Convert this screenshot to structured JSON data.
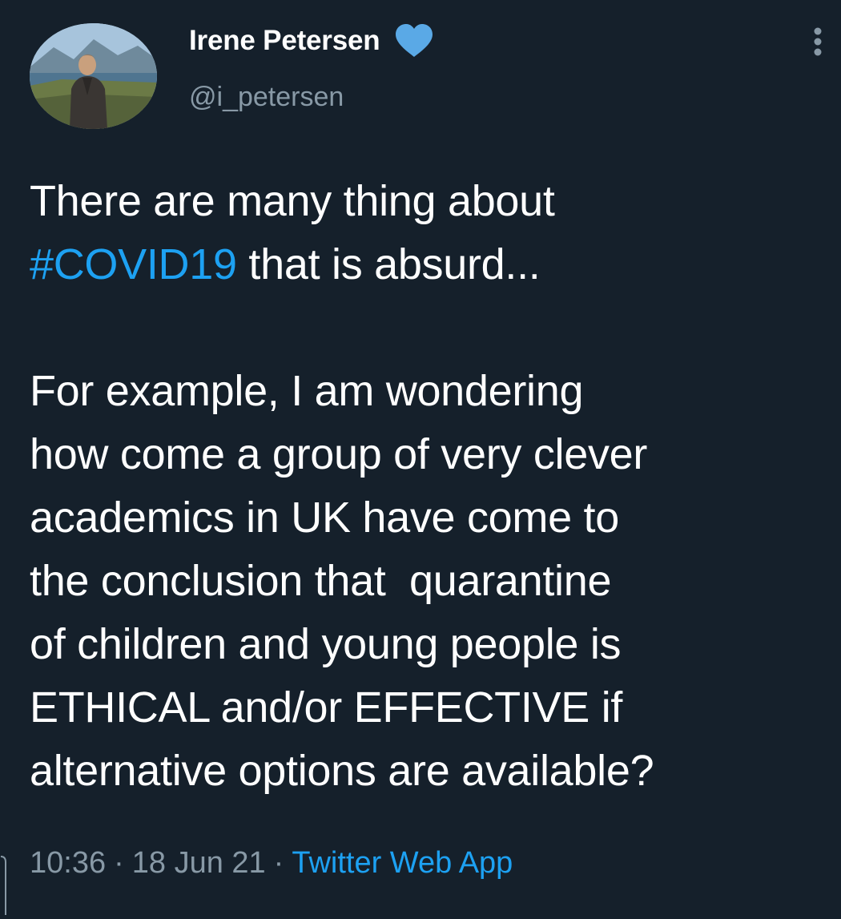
{
  "user": {
    "display_name": "Irene Petersen",
    "handle": "@i_petersen",
    "verified": true
  },
  "tweet": {
    "lines": [
      {
        "parts": [
          {
            "text": "There are many thing about",
            "type": "text"
          }
        ]
      },
      {
        "parts": [
          {
            "text": "#COVID19",
            "type": "hashtag"
          },
          {
            "text": " that is absurd...",
            "type": "text"
          }
        ]
      },
      {
        "parts": [
          {
            "text": "",
            "type": "text"
          }
        ]
      },
      {
        "parts": [
          {
            "text": "For example, I am wondering",
            "type": "text"
          }
        ]
      },
      {
        "parts": [
          {
            "text": "how come a group of very clever",
            "type": "text"
          }
        ]
      },
      {
        "parts": [
          {
            "text": "academics in UK have come to",
            "type": "text"
          }
        ]
      },
      {
        "parts": [
          {
            "text": "the conclusion that  quarantine",
            "type": "text"
          }
        ]
      },
      {
        "parts": [
          {
            "text": "of children and young people is",
            "type": "text"
          }
        ]
      },
      {
        "parts": [
          {
            "text": "ETHICAL and/or EFFECTIVE if",
            "type": "text"
          }
        ]
      },
      {
        "parts": [
          {
            "text": "alternative options are available?",
            "type": "text"
          }
        ]
      }
    ]
  },
  "meta": {
    "time": "10:36",
    "date": "18 Jun 21",
    "separator": "·",
    "source": "Twitter Web App"
  },
  "colors": {
    "background": "#15202b",
    "text": "#ffffff",
    "secondary": "#8899a6",
    "accent": "#1da1f2",
    "verified_badge": "#5aa9e6"
  },
  "icons": {
    "verified": "verified-heart-icon",
    "more": "more-options-icon"
  }
}
